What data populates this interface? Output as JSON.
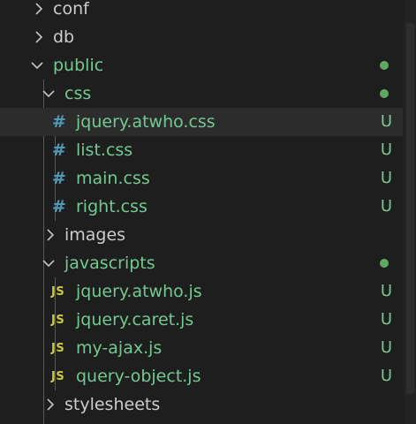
{
  "colors": {
    "background": "#1e1e1e",
    "selected_row": "#2c2c2d",
    "folder_text": "#cccccc",
    "untracked_green": "#73c991",
    "css_icon": "#519aba",
    "js_icon": "#cbcb41",
    "modified_dot": "#5fa866"
  },
  "tree": {
    "conf": {
      "label": "conf",
      "state": "collapsed"
    },
    "db": {
      "label": "db",
      "state": "collapsed"
    },
    "public": {
      "label": "public",
      "state": "expanded",
      "decoration": "modified-dot"
    },
    "css": {
      "label": "css",
      "state": "expanded",
      "decoration": "modified-dot"
    },
    "css_files": [
      {
        "label": "jquery.atwho.css",
        "icon": "#",
        "status": "U",
        "selected": true
      },
      {
        "label": "list.css",
        "icon": "#",
        "status": "U"
      },
      {
        "label": "main.css",
        "icon": "#",
        "status": "U"
      },
      {
        "label": "right.css",
        "icon": "#",
        "status": "U"
      }
    ],
    "images": {
      "label": "images",
      "state": "collapsed"
    },
    "javascripts": {
      "label": "javascripts",
      "state": "expanded",
      "decoration": "modified-dot"
    },
    "js_files": [
      {
        "label": "jquery.atwho.js",
        "icon": "JS",
        "status": "U"
      },
      {
        "label": "jquery.caret.js",
        "icon": "JS",
        "status": "U"
      },
      {
        "label": "my-ajax.js",
        "icon": "JS",
        "status": "U"
      },
      {
        "label": "query-object.js",
        "icon": "JS",
        "status": "U"
      }
    ],
    "stylesheets": {
      "label": "stylesheets",
      "state": "collapsed"
    }
  }
}
